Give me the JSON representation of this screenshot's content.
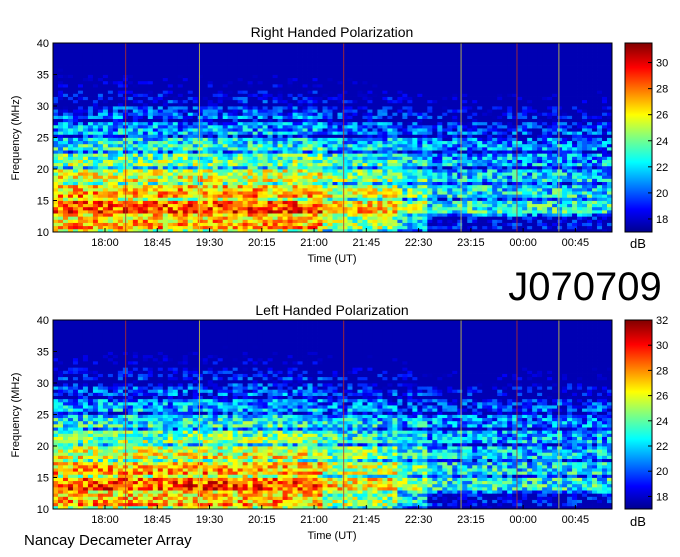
{
  "header": {
    "id_label": "J070709"
  },
  "footer": {
    "credit": "Nancay Decameter Array"
  },
  "chart_data": [
    {
      "type": "heatmap",
      "title": "Right Handed Polarization",
      "xlabel": "Time (UT)",
      "ylabel": "Frequency (MHz)",
      "x_ticks": [
        "18:00",
        "18:45",
        "19:30",
        "20:15",
        "21:00",
        "21:45",
        "22:30",
        "23:15",
        "00:00",
        "00:45"
      ],
      "y_ticks": [
        10,
        15,
        20,
        25,
        30,
        35,
        40
      ],
      "ylim": [
        10,
        40
      ],
      "colorbar": {
        "label": "dB",
        "ticks": [
          18,
          20,
          22,
          24,
          26,
          28,
          30
        ],
        "range": [
          17,
          31.5
        ]
      }
    },
    {
      "type": "heatmap",
      "title": "Left Handed Polarization",
      "xlabel": "Time (UT)",
      "ylabel": "Frequency (MHz)",
      "x_ticks": [
        "18:00",
        "18:45",
        "19:30",
        "20:15",
        "21:00",
        "21:45",
        "22:30",
        "23:15",
        "00:00",
        "00:45"
      ],
      "y_ticks": [
        10,
        15,
        20,
        25,
        30,
        35,
        40
      ],
      "ylim": [
        10,
        40
      ],
      "colorbar": {
        "label": "dB",
        "ticks": [
          18,
          20,
          22,
          24,
          26,
          28,
          30,
          32
        ],
        "range": [
          17,
          32
        ]
      }
    }
  ]
}
